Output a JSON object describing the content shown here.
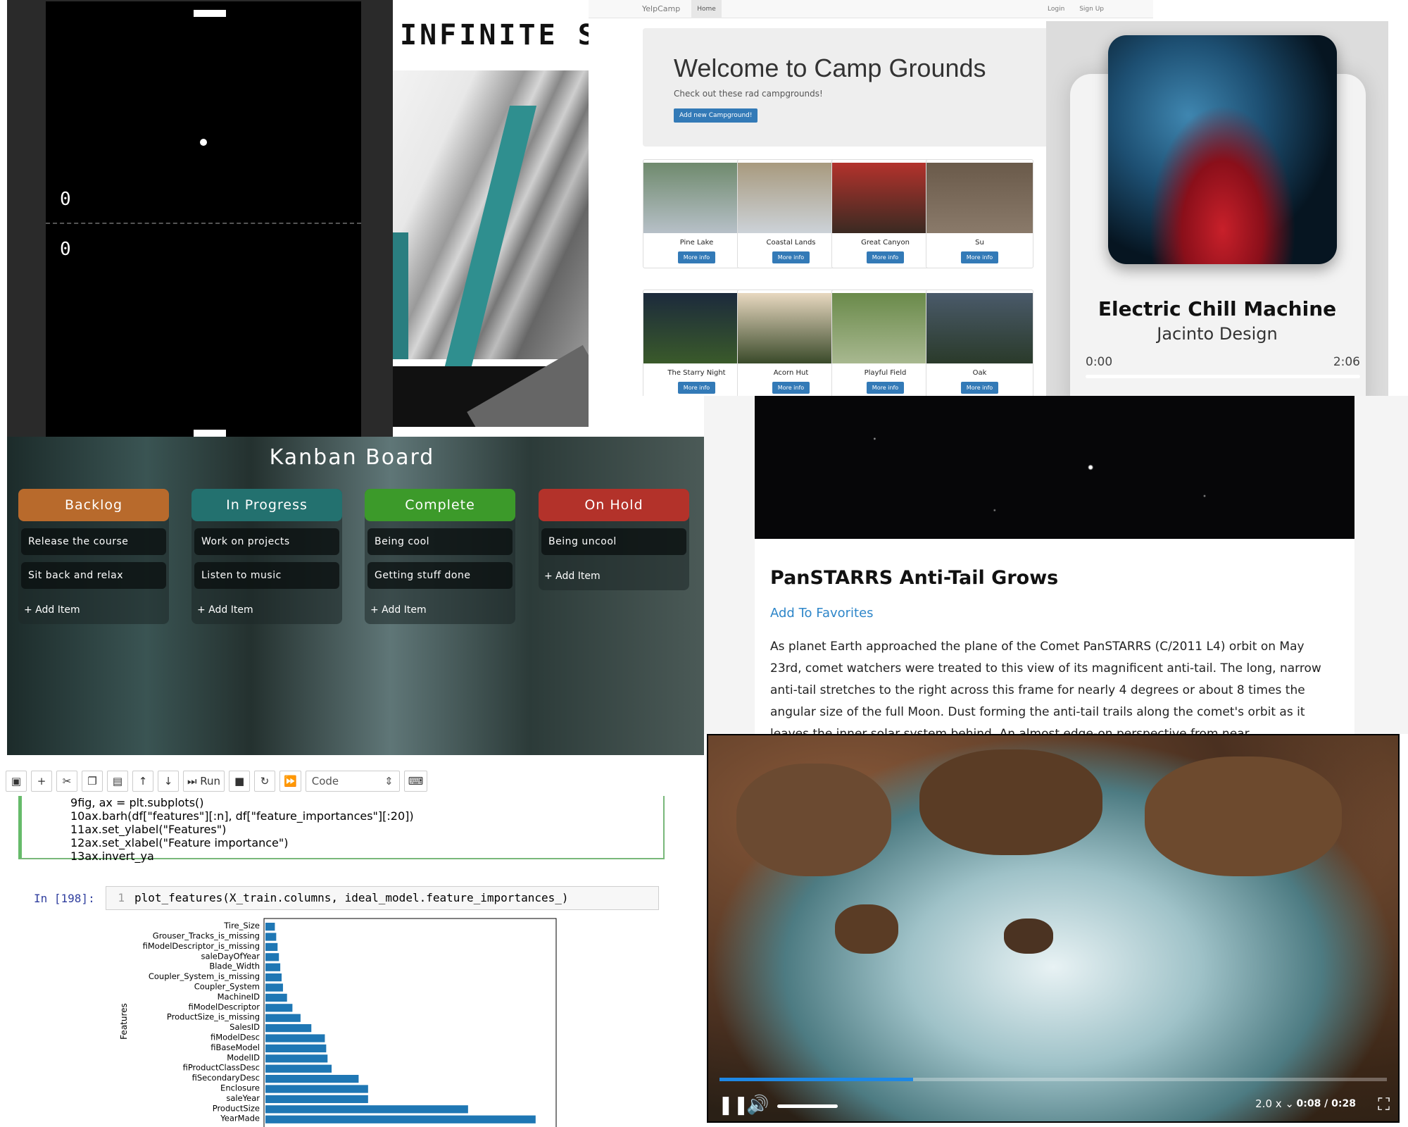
{
  "pong": {
    "score_top": "0",
    "score_bottom": "0"
  },
  "infinite_scroll": {
    "title": "INFINITE SCROL"
  },
  "yelpcamp": {
    "brand": "YelpCamp",
    "nav_home": "Home",
    "nav_login": "Login",
    "nav_signup": "Sign Up",
    "heading": "Welcome to Camp Grounds",
    "subheading": "Check out these rad campgrounds!",
    "add_button": "Add new Campground!",
    "more_info": "More info",
    "campgrounds": [
      "Pine Lake",
      "Coastal Lands",
      "Great Canyon",
      "Su",
      "The Starry Night",
      "Acorn Hut",
      "Playful Field",
      "Oak"
    ]
  },
  "music": {
    "title": "Electric Chill Machine",
    "artist": "Jacinto Design",
    "current_time": "0:00",
    "duration": "2:06",
    "progress": 0
  },
  "kanban": {
    "title": "Kanban Board",
    "add_item": "+ Add Item",
    "columns": [
      {
        "name": "Backlog",
        "color": "#b86a2c",
        "items": [
          "Release the course",
          "Sit back and relax"
        ]
      },
      {
        "name": "In Progress",
        "color": "#23716f",
        "items": [
          "Work on projects",
          "Listen to music"
        ]
      },
      {
        "name": "Complete",
        "color": "#3c9a2a",
        "items": [
          "Being cool",
          "Getting stuff done"
        ]
      },
      {
        "name": "On Hold",
        "color": "#b3322a",
        "items": [
          "Being uncool"
        ]
      }
    ]
  },
  "astro": {
    "title": "PanSTARRS Anti-Tail Grows",
    "favorite_link": "Add To Favorites",
    "body": "As planet Earth approached the plane of the Comet PanSTARRS (C/2011 L4) orbit on May 23rd, comet watchers were treated to this view of its magnificent anti-tail. The long, narrow anti-tail stretches to the right across this frame for nearly 4 degrees or about 8 times the angular size of the full Moon. Dust forming the anti-tail trails along the comet's orbit as it leaves the inner solar system behind. An almost edge-on perspective from near"
  },
  "jupyter": {
    "run_label": "Run",
    "cell_type": "Code",
    "code_lines": [
      {
        "n": "9",
        "text": "fig, ax = plt.subplots()"
      },
      {
        "n": "10",
        "text": "ax.barh(df[\"features\"][:n], df[\"feature_importances\"][:20])"
      },
      {
        "n": "11",
        "text": "ax.set_ylabel(\"Features\")"
      },
      {
        "n": "12",
        "text": "ax.set_xlabel(\"Feature importance\")"
      },
      {
        "n": "13",
        "text": "ax.invert_ya"
      }
    ],
    "in_prompt": "In [198]:",
    "in_line_no": "1",
    "in_code": "plot_features(X_train.columns, ideal_model.feature_importances_)"
  },
  "chart_data": {
    "type": "bar",
    "orientation": "horizontal",
    "ylabel": "Features",
    "categories": [
      "Tire_Size",
      "Grouser_Tracks_is_missing",
      "fiModelDescriptor_is_missing",
      "saleDayOfYear",
      "Blade_Width",
      "Coupler_System_is_missing",
      "Coupler_System",
      "MachineID",
      "fiModelDescriptor",
      "ProductSize_is_missing",
      "SalesID",
      "fiModelDesc",
      "fiBaseModel",
      "ModelID",
      "fiProductClassDesc",
      "fiSecondaryDesc",
      "Enclosure",
      "saleYear",
      "ProductSize",
      "YearMade"
    ],
    "values": [
      0.007,
      0.008,
      0.009,
      0.01,
      0.011,
      0.012,
      0.013,
      0.016,
      0.02,
      0.026,
      0.034,
      0.044,
      0.045,
      0.046,
      0.049,
      0.069,
      0.076,
      0.076,
      0.15,
      0.2
    ],
    "xlim": [
      0,
      0.21
    ],
    "color": "#1f77b4"
  },
  "video": {
    "speed": "2.0 x",
    "time": "0:08 / 0:28",
    "progress": 0.29
  }
}
